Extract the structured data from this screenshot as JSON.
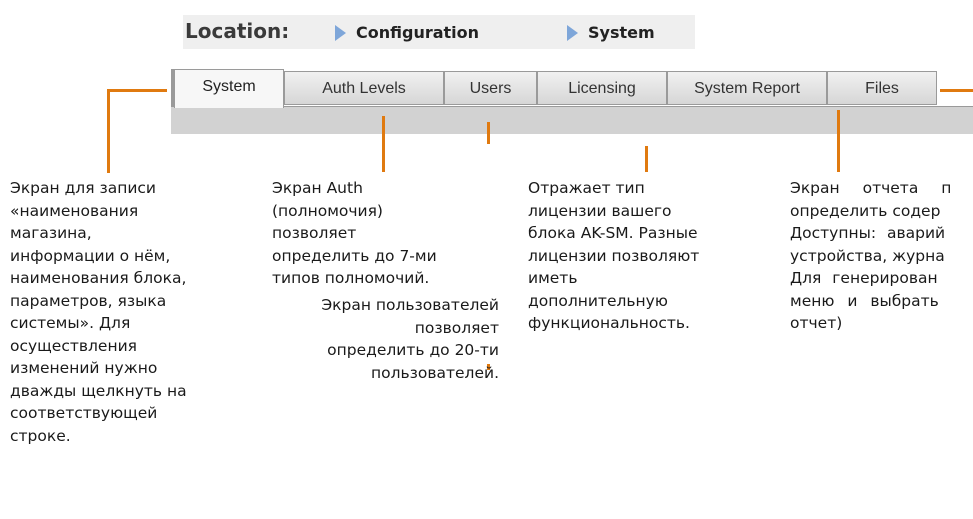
{
  "location": {
    "label": "Location:",
    "crumbs": [
      "Configuration",
      "System"
    ]
  },
  "tabs": [
    {
      "label": "System",
      "active": true
    },
    {
      "label": "Auth Levels",
      "active": false
    },
    {
      "label": "Users",
      "active": false
    },
    {
      "label": "Licensing",
      "active": false
    },
    {
      "label": "System Report",
      "active": false
    },
    {
      "label": "Files",
      "active": false
    }
  ],
  "annotations": {
    "system": [
      "Экран для записи",
      "«наименования",
      "магазина,",
      "информации о нём,",
      "наименования блока,",
      "параметров, языка",
      "системы». Для",
      "осуществления",
      "изменений нужно",
      "дважды щелкнуть на",
      "соответствующей",
      "строке."
    ],
    "auth": [
      "Экран Auth",
      "(полномочия)",
      "позволяет",
      "определить до 7-ми",
      "типов полномочий."
    ],
    "users": [
      "Экран пользователей",
      "позволяет",
      "определить до 20-ти",
      "пользователей."
    ],
    "licensing": [
      "Отражает тип",
      "лицензии вашего",
      "блока AK-SM. Разные",
      "лицензии позволяют",
      "иметь",
      "дополнительную",
      "функциональность."
    ],
    "report": [
      "Экран отчета п",
      "определить содер",
      "Доступны: аварий",
      "устройства, журна",
      "Для генерирован",
      "меню и выбрать",
      "отчет)"
    ]
  },
  "colors": {
    "leader": "#e07a10",
    "crumb_arrow": "#7ea6d9"
  }
}
